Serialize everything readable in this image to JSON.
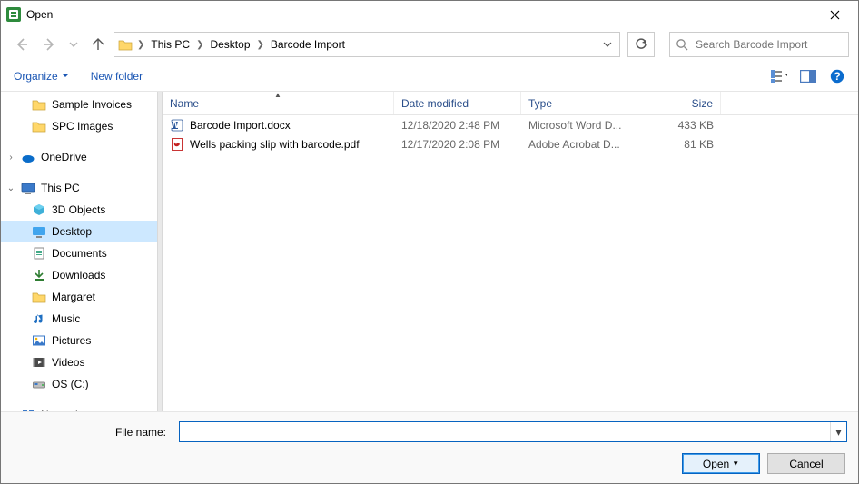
{
  "window": {
    "title": "Open"
  },
  "nav": {
    "breadcrumb": [
      "This PC",
      "Desktop",
      "Barcode Import"
    ],
    "search_placeholder": "Search Barcode Import"
  },
  "toolbar": {
    "organize": "Organize",
    "new_folder": "New folder"
  },
  "tree": {
    "items": [
      {
        "label": "Sample Invoices",
        "icon": "folder-icon",
        "sub": true
      },
      {
        "label": "SPC Images",
        "icon": "folder-icon",
        "sub": true
      },
      {
        "label": "OneDrive",
        "icon": "onedrive-icon",
        "expandable": true
      },
      {
        "label": "This PC",
        "icon": "thispc-icon",
        "expandable": true,
        "expanded": true
      },
      {
        "label": "3D Objects",
        "icon": "objects3d-icon",
        "sub": true
      },
      {
        "label": "Desktop",
        "icon": "desktop-icon",
        "sub": true,
        "selected": true
      },
      {
        "label": "Documents",
        "icon": "documents-icon",
        "sub": true
      },
      {
        "label": "Downloads",
        "icon": "downloads-icon",
        "sub": true
      },
      {
        "label": "Margaret",
        "icon": "folder-icon",
        "sub": true
      },
      {
        "label": "Music",
        "icon": "music-icon",
        "sub": true
      },
      {
        "label": "Pictures",
        "icon": "pictures-icon",
        "sub": true
      },
      {
        "label": "Videos",
        "icon": "videos-icon",
        "sub": true
      },
      {
        "label": "OS (C:)",
        "icon": "drive-icon",
        "sub": true
      },
      {
        "label": "Network",
        "icon": "network-icon",
        "expandable": true
      }
    ]
  },
  "columns": {
    "name": "Name",
    "date": "Date modified",
    "type": "Type",
    "size": "Size"
  },
  "files": [
    {
      "name": "Barcode Import.docx",
      "date": "12/18/2020 2:48 PM",
      "type": "Microsoft Word D...",
      "size": "433 KB",
      "icon": "docx-icon"
    },
    {
      "name": "Wells packing slip with barcode.pdf",
      "date": "12/17/2020 2:08 PM",
      "type": "Adobe Acrobat D...",
      "size": "81 KB",
      "icon": "pdf-icon"
    }
  ],
  "footer": {
    "filename_label": "File name:",
    "filename_value": "",
    "open": "Open",
    "cancel": "Cancel"
  }
}
